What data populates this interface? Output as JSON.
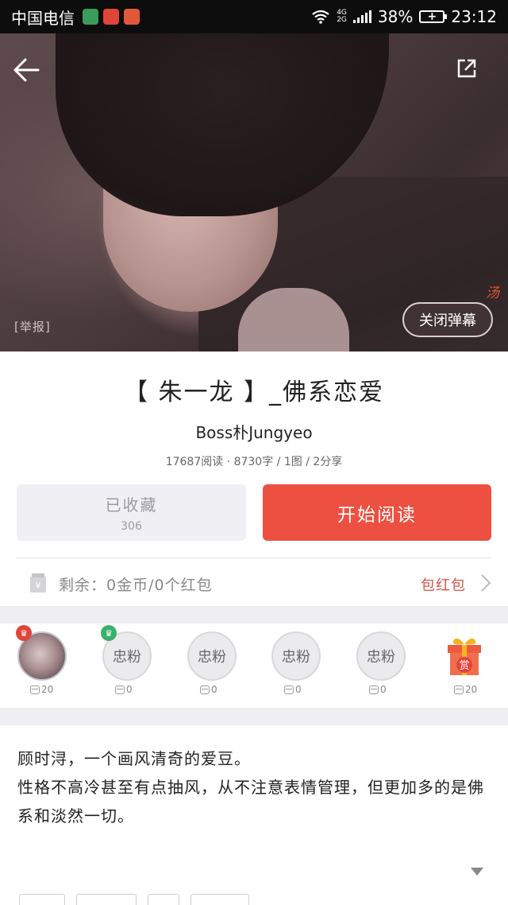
{
  "status_bar": {
    "carrier": "中国电信",
    "network_top": "4G",
    "network_bottom": "2G",
    "battery_percent": "38%",
    "time": "23:12",
    "app_colors": [
      "#3a9d5b",
      "#e0453a",
      "#e05a3a"
    ]
  },
  "hero": {
    "report_label": "[举报]",
    "danmu_tag": "汤",
    "close_danmu_label": "关闭弹幕"
  },
  "work": {
    "title": "【 朱一龙 】_佛系恋爱",
    "author": "Boss朴Jungyeo",
    "stats": "17687阅读 · 8730字 / 1图 / 2分享"
  },
  "actions": {
    "favorite_label": "已收藏",
    "favorite_count": "306",
    "read_label": "开始阅读"
  },
  "red_packet": {
    "remaining_text": "剩余：0金币/0个红包",
    "link_label": "包红包"
  },
  "fans": [
    {
      "label": "",
      "coins": "20",
      "is_avatar": true
    },
    {
      "label": "忠粉",
      "coins": "0"
    },
    {
      "label": "忠粉",
      "coins": "0"
    },
    {
      "label": "忠粉",
      "coins": "0"
    },
    {
      "label": "忠粉",
      "coins": "0"
    },
    {
      "label": "赏",
      "coins": "20"
    }
  ],
  "description": {
    "line1": "顾时浔，一个画风清奇的爱豆。",
    "line2": "性格不高冷甚至有点抽风，从不注意表情管理，但更加多的是佛系和淡然一切。"
  },
  "colors": {
    "accent": "#ed5040",
    "link_red": "#d9534a",
    "band": "#efeff3"
  }
}
